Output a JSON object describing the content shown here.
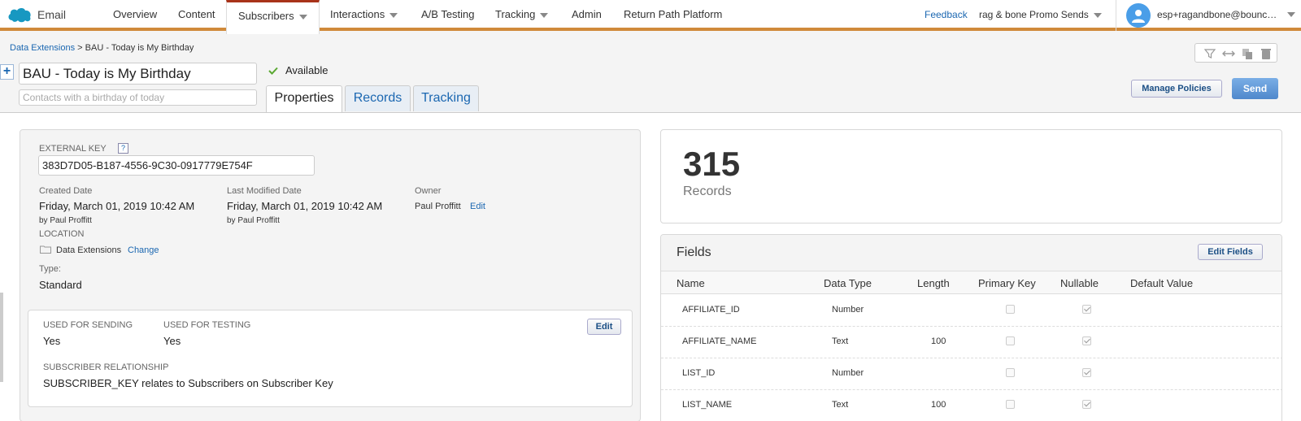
{
  "nav": {
    "app_name": "Email",
    "items": [
      "Overview",
      "Content",
      "Subscribers",
      "Interactions",
      "A/B Testing",
      "Tracking",
      "Admin",
      "Return Path Platform"
    ],
    "feedback": "Feedback",
    "business_unit": "rag & bone Promo Sends",
    "user_email": "esp+ragandbone@bounceexchange.com"
  },
  "header": {
    "breadcrumb_root": "Data Extensions",
    "breadcrumb_sep": ">",
    "breadcrumb_current": "BAU - Today is My Birthday",
    "title": "BAU - Today is My Birthday",
    "description_placeholder": "Contacts with a birthday of today",
    "status": "Available",
    "tabs": [
      "Properties",
      "Records",
      "Tracking"
    ],
    "manage_policies": "Manage Policies",
    "send": "Send"
  },
  "props": {
    "external_key_label": "EXTERNAL KEY",
    "help": "?",
    "external_key": "383D7D05-B187-4556-9C30-0917779E754F",
    "created_label": "Created Date",
    "created_value": "Friday, March 01, 2019 10:42 AM",
    "created_by": "by Paul Proffitt",
    "modified_label": "Last Modified Date",
    "modified_value": "Friday, March 01, 2019 10:42 AM",
    "modified_by": "by Paul Proffitt",
    "owner_label": "Owner",
    "owner_value": "Paul Proffitt",
    "owner_edit": "Edit",
    "location_label": "LOCATION",
    "location_value": "Data Extensions",
    "location_change": "Change",
    "type_label": "Type:",
    "type_value": "Standard",
    "usage": {
      "sending_label": "USED FOR SENDING",
      "sending_value": "Yes",
      "testing_label": "USED FOR TESTING",
      "testing_value": "Yes",
      "edit": "Edit",
      "relationship_label": "SUBSCRIBER RELATIONSHIP",
      "relationship_value": "SUBSCRIBER_KEY relates to Subscribers on Subscriber Key"
    }
  },
  "records": {
    "count": "315",
    "label": "Records"
  },
  "fields": {
    "title": "Fields",
    "edit_button": "Edit Fields",
    "columns": [
      "Name",
      "Data Type",
      "Length",
      "Primary Key",
      "Nullable",
      "Default Value"
    ],
    "rows": [
      {
        "name": "AFFILIATE_ID",
        "type": "Number",
        "length": "",
        "primary": false,
        "nullable": true
      },
      {
        "name": "AFFILIATE_NAME",
        "type": "Text",
        "length": "100",
        "primary": false,
        "nullable": true
      },
      {
        "name": "LIST_ID",
        "type": "Number",
        "length": "",
        "primary": false,
        "nullable": true
      },
      {
        "name": "LIST_NAME",
        "type": "Text",
        "length": "100",
        "primary": false,
        "nullable": true
      }
    ]
  },
  "colors": {
    "accent_bar": "#d08a3a",
    "link": "#1b67b1",
    "send_button": "#4f88cc"
  }
}
